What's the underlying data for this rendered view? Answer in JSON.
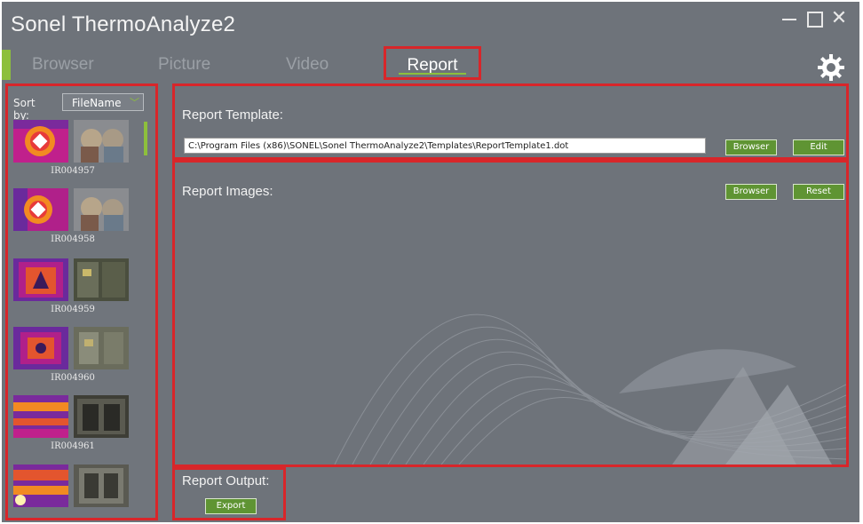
{
  "app": {
    "title": "Sonel ThermoAnalyze2"
  },
  "window": {
    "minimize": "—",
    "maximize": "☐",
    "close": "✕"
  },
  "tabs": [
    {
      "label": "Browser"
    },
    {
      "label": "Picture"
    },
    {
      "label": "Video"
    },
    {
      "label": "Report"
    }
  ],
  "sidebar": {
    "sort_label": "Sort by:",
    "sort_value": "FileName",
    "items": [
      {
        "name": "IR004957"
      },
      {
        "name": "IR004958"
      },
      {
        "name": "IR004959"
      },
      {
        "name": "IR004960"
      },
      {
        "name": "IR004961"
      }
    ]
  },
  "report": {
    "template_label": "Report Template:",
    "template_path": "C:\\Program Files (x86)\\SONEL\\Sonel ThermoAnalyze2\\Templates\\ReportTemplate1.dot",
    "template_browse": "Browser",
    "template_edit": "Edit",
    "images_label": "Report Images:",
    "images_browse": "Browser",
    "images_reset": "Reset",
    "output_label": "Report Output:",
    "export": "Export"
  },
  "colors": {
    "accent": "#8dbf3c",
    "highlight": "#d8262a",
    "button": "#5f9433",
    "background": "#6e737a"
  }
}
